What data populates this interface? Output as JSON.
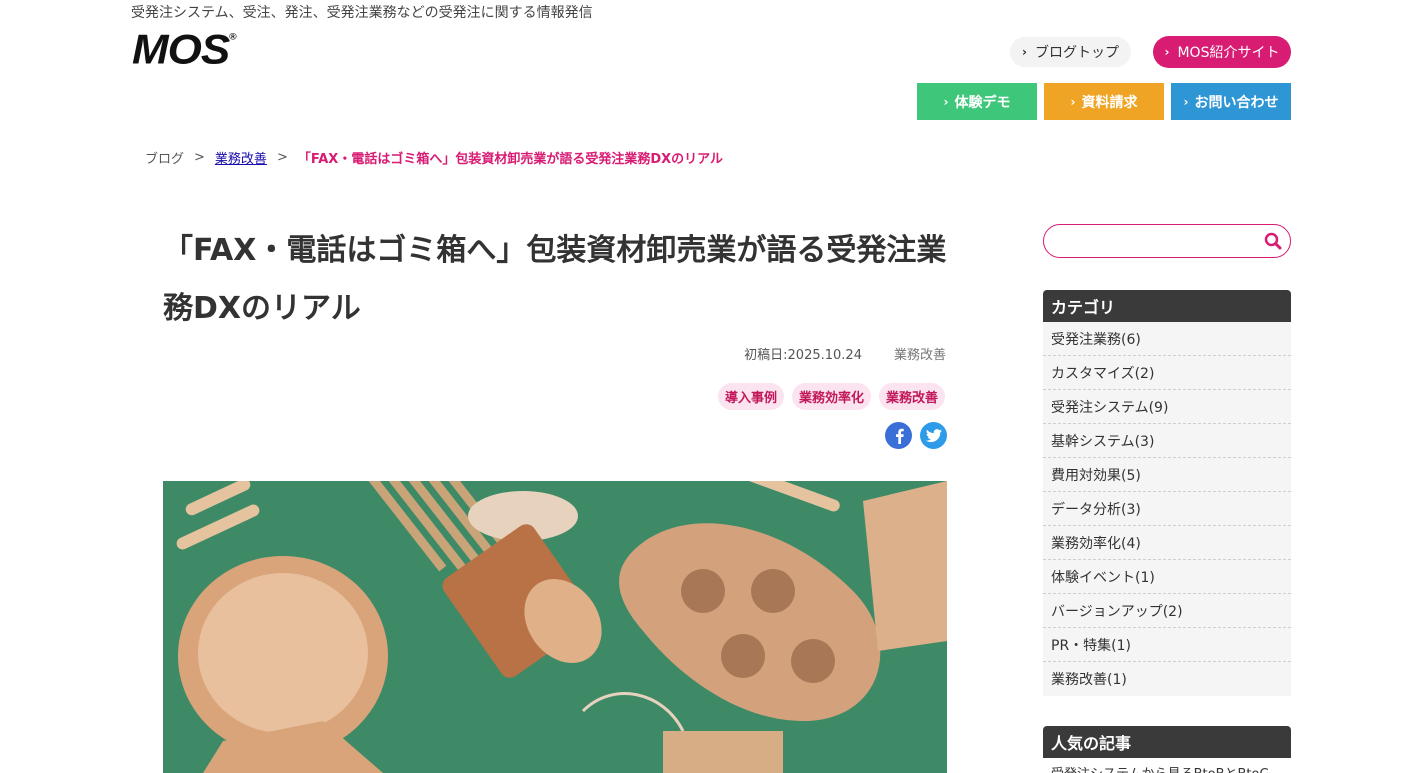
{
  "header": {
    "tagline": "受発注システム、受注、発注、受発注業務などの受発注に関する情報発信",
    "logo": "MOS",
    "logo_mark": "®",
    "blog_top": "ブログトップ",
    "mos_site": "MOS紹介サイト"
  },
  "cta": {
    "demo": "体験デモ",
    "docs": "資料請求",
    "contact": "お問い合わせ"
  },
  "breadcrumb": {
    "home": "ブログ",
    "sep": ">",
    "category": "業務改善",
    "current": "「FAX・電話はゴミ箱へ」包装資材卸売業が語る受発注業務DXのリアル"
  },
  "article": {
    "title": "「FAX・電話はゴミ箱へ」包装資材卸売業が語る受発注業務DXのリアル",
    "date": "初稿日:2025.10.24",
    "category": "業務改善",
    "tags": [
      "導入事例",
      "業務効率化",
      "業務改善"
    ]
  },
  "sidebar": {
    "search_placeholder": "",
    "category_heading": "カテゴリ",
    "categories": [
      "受発注業務(6)",
      "カスタマイズ(2)",
      "受発注システム(9)",
      "基幹システム(3)",
      "費用対効果(5)",
      "データ分析(3)",
      "業務効率化(4)",
      "体験イベント(1)",
      "バージョンアップ(2)",
      "PR・特集(1)",
      "業務改善(1)"
    ],
    "popular_heading": "人気の記事",
    "popular_first": "受発注システムから見るBtoBとBtoC"
  },
  "colors": {
    "brand": "#d81b73",
    "demo": "#3ec77a",
    "docs": "#f0a425",
    "contact": "#2f96d6",
    "hero_bg": "#3f8a66"
  },
  "icons": {
    "chevron": "chevron-right-icon",
    "search": "search-icon",
    "facebook": "facebook-icon",
    "twitter": "twitter-icon"
  }
}
